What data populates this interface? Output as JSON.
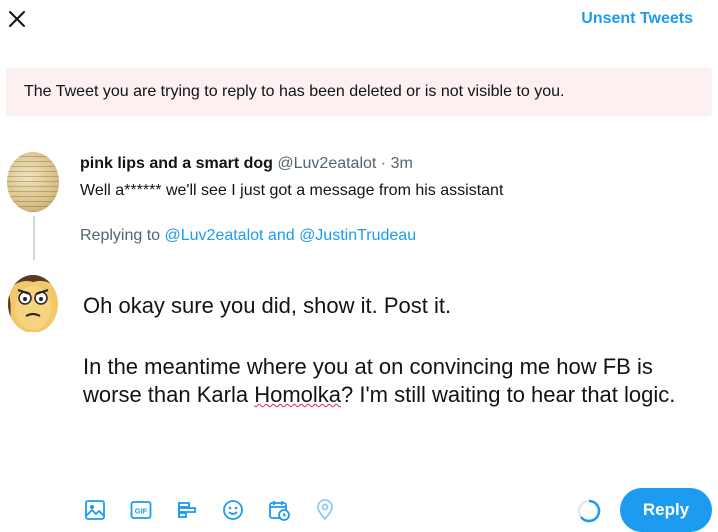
{
  "header": {
    "close_icon": "close-icon",
    "unsent_tweets_label": "Unsent Tweets"
  },
  "notice": {
    "text": "The Tweet you are trying to reply to has been deleted or is not visible to you."
  },
  "original_tweet": {
    "display_name": "pink lips and a smart dog",
    "handle": "@Luv2eatalot",
    "separator": " · ",
    "time": "3m",
    "text": "Well a****** we'll see I just got a message from his assistant"
  },
  "replying": {
    "prefix": "Replying to ",
    "users": "@Luv2eatalot and @JustinTrudeau"
  },
  "compose": {
    "paragraph1": "Oh okay sure you did, show it. Post it.",
    "paragraph2_before": "In the meantime where you at on convincing me how FB is worse than Karla ",
    "paragraph2_misspelled": "Homolka",
    "paragraph2_after": "? I'm still waiting to hear that logic."
  },
  "toolbar": {
    "icons": [
      "media-icon",
      "gif-icon",
      "poll-icon",
      "emoji-icon",
      "schedule-icon",
      "location-icon"
    ],
    "accent_color": "#1d9bf0"
  },
  "reply_button": {
    "label": "Reply"
  },
  "colors": {
    "accent": "#1d9bf0",
    "notice_bg": "#fdf0f1",
    "secondary_text": "#536471"
  }
}
